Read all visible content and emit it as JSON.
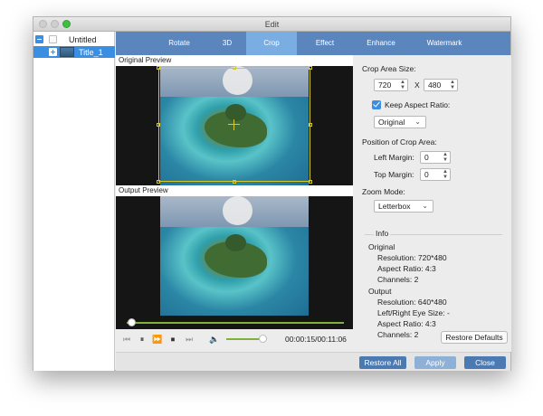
{
  "window": {
    "title": "Edit"
  },
  "sidebar": {
    "items": [
      {
        "label": "Untitled"
      },
      {
        "label": "Title_1",
        "selected": true
      }
    ]
  },
  "tabs": [
    {
      "label": "Rotate"
    },
    {
      "label": "3D"
    },
    {
      "label": "Crop",
      "active": true
    },
    {
      "label": "Effect"
    },
    {
      "label": "Enhance"
    },
    {
      "label": "Watermark"
    }
  ],
  "preview": {
    "original_label": "Original Preview",
    "output_label": "Output Preview"
  },
  "playback": {
    "timecode": "00:00:15/00:11:06",
    "progress_fraction": 0.02,
    "volume_fraction": 0.9,
    "icons": [
      "skip-back-icon",
      "pause-icon",
      "fast-forward-icon",
      "stop-icon",
      "skip-forward-icon",
      "volume-icon"
    ]
  },
  "crop": {
    "area_size_label": "Crop Area Size:",
    "width": "720",
    "separator": "X",
    "height": "480",
    "keep_aspect_label": "Keep Aspect Ratio:",
    "keep_aspect_checked": true,
    "aspect_option": "Original",
    "position_label": "Position of Crop Area:",
    "left_margin_label": "Left Margin:",
    "left_margin": "0",
    "top_margin_label": "Top Margin:",
    "top_margin": "0",
    "zoom_mode_label": "Zoom Mode:",
    "zoom_mode": "Letterbox"
  },
  "info": {
    "title": "Info",
    "original_title": "Original",
    "original_resolution": "Resolution: 720*480",
    "original_aspect": "Aspect Ratio: 4:3",
    "original_channels": "Channels: 2",
    "output_title": "Output",
    "output_resolution": "Resolution: 640*480",
    "output_eye_size": "Left/Right Eye Size: -",
    "output_aspect": "Aspect Ratio: 4:3",
    "output_channels": "Channels: 2"
  },
  "buttons": {
    "restore_defaults": "Restore Defaults",
    "restore_all": "Restore All",
    "apply": "Apply",
    "close": "Close"
  },
  "colors": {
    "tab_bar": "#5b86bd",
    "tab_active": "#7aaee3",
    "progress": "#7fb23a",
    "selection": "#3b8fe3",
    "crop_frame": "#d9c82a"
  }
}
